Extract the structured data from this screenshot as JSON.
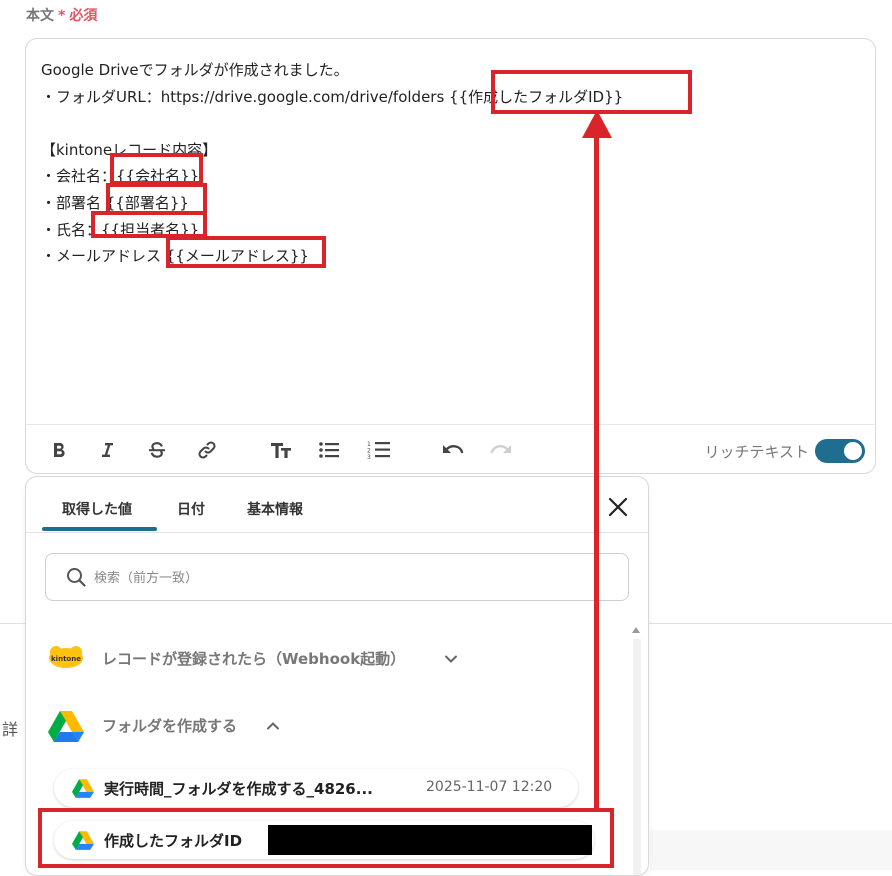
{
  "field": {
    "label": "本文",
    "required_mark": "*",
    "required_text": "必須"
  },
  "editor": {
    "lines": [
      "Google Driveでフォルダが作成されました。",
      "・フォルダURL：https://drive.google.com/drive/folders {{作成したフォルダID}}",
      "",
      "【kintoneレコード内容】",
      "・会社名：{{会社名}}",
      "・部署名 {{部署名}}",
      "・氏名：{{担当者名}}",
      "・メールアドレス {{メールアドレス}}"
    ],
    "rich_text_label": "リッチテキスト",
    "rich_text_enabled": true
  },
  "picker": {
    "tabs": [
      {
        "label": "取得した値",
        "active": true
      },
      {
        "label": "日付",
        "active": false
      },
      {
        "label": "基本情報",
        "active": false
      }
    ],
    "search_placeholder": "検索（前方一致）",
    "groups": [
      {
        "title": "レコードが登録されたら（Webhook起動）",
        "icon": "kintone-icon",
        "expanded": false
      },
      {
        "title": "フォルダを作成する",
        "icon": "google-drive-icon",
        "expanded": true
      }
    ],
    "items": [
      {
        "name": "実行時間_フォルダを作成する_4826...",
        "value": "2025-11-07 12:20"
      },
      {
        "name": "作成したフォルダID",
        "value": ""
      }
    ]
  },
  "side_text": "詳",
  "kintone_logo_text": "kintone",
  "colors": {
    "accent": "#1f6d8f",
    "highlight": "#d9252a",
    "required": "#e25563"
  }
}
